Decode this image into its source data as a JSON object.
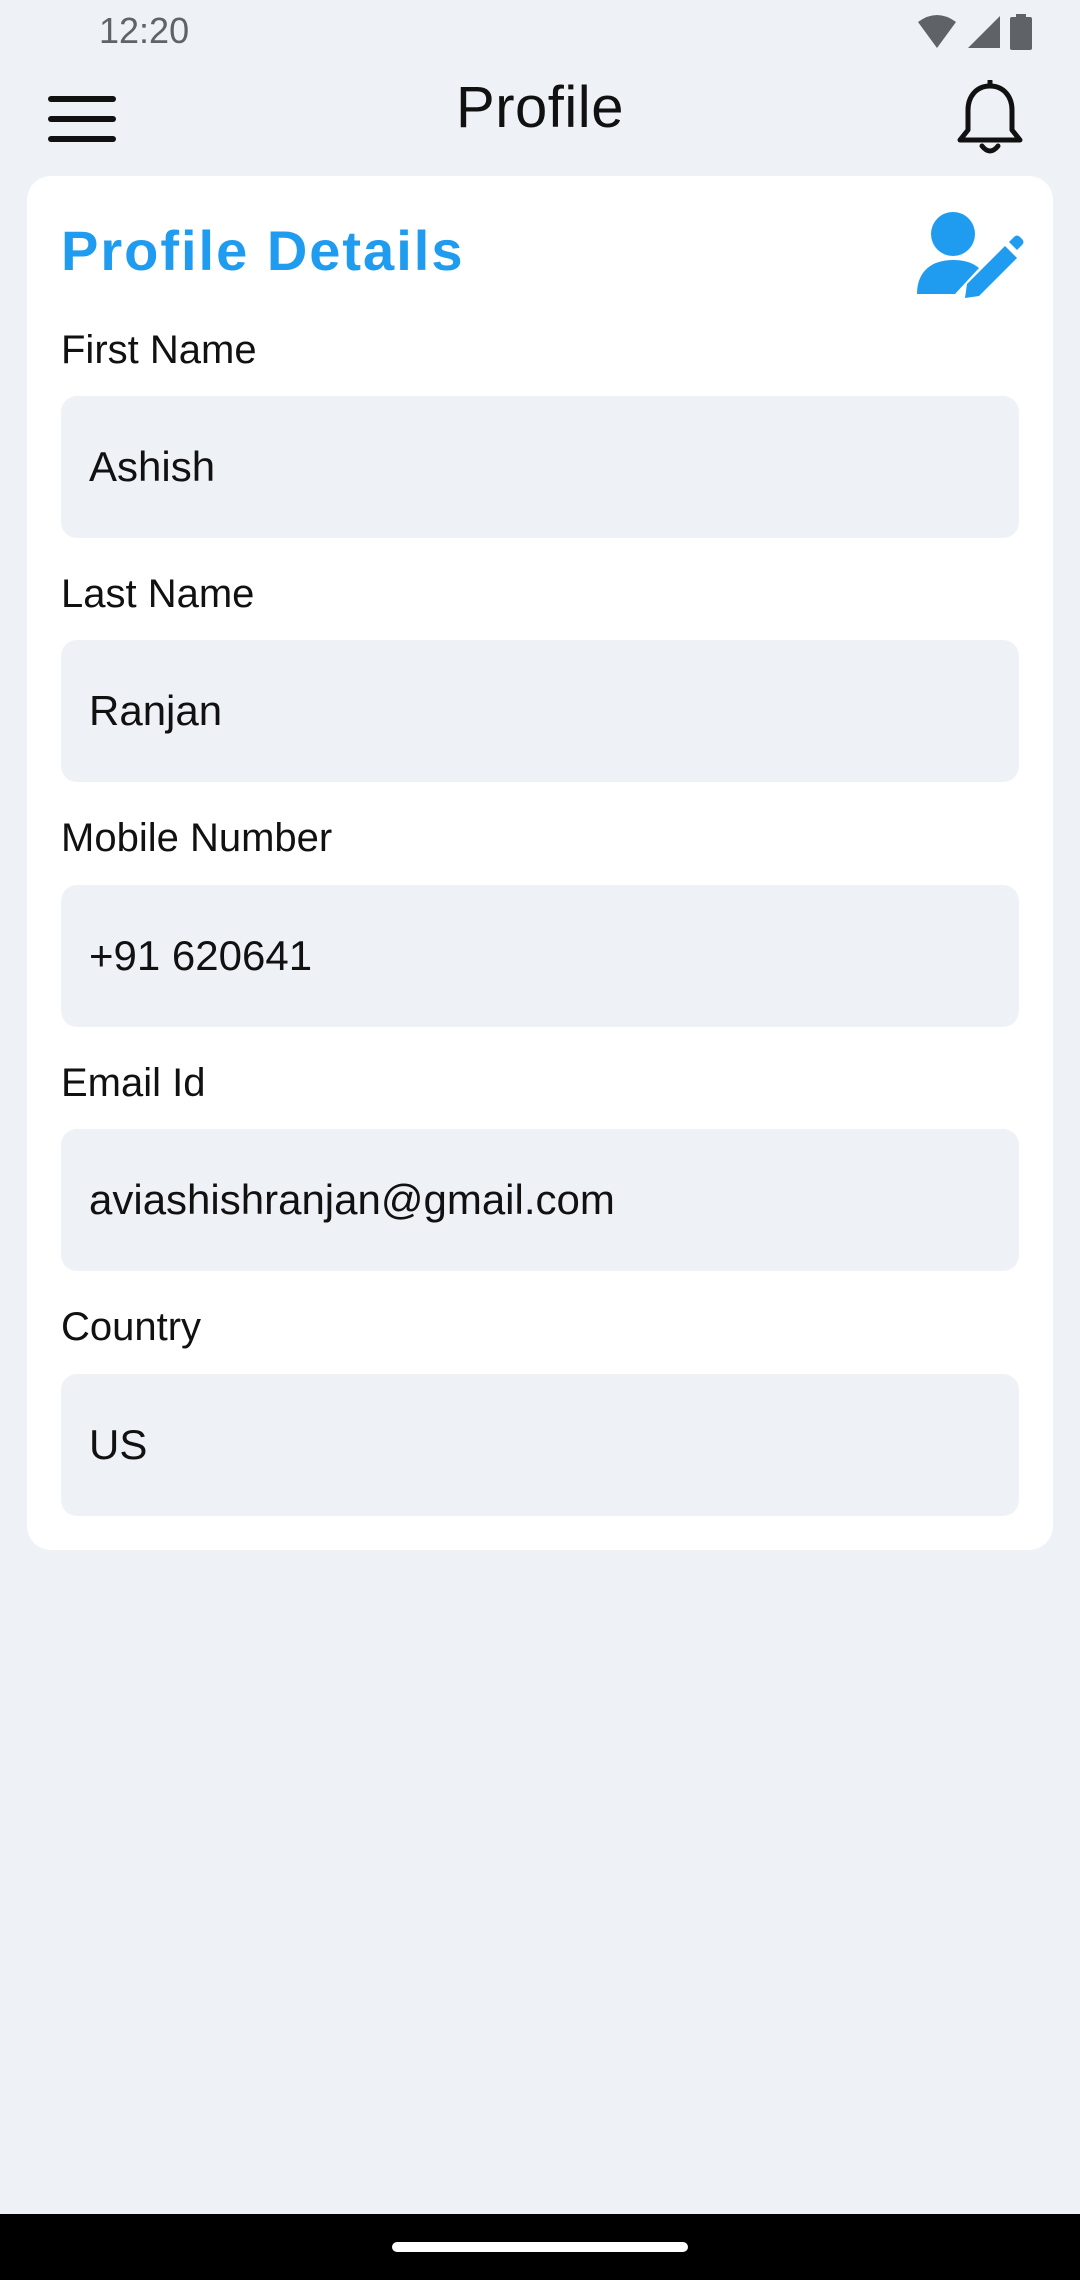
{
  "status_bar": {
    "time": "12:20",
    "icons": [
      "wifi-icon",
      "cellular-signal-icon",
      "battery-icon"
    ]
  },
  "app_bar": {
    "title": "Profile",
    "menu_icon": "hamburger-menu-icon",
    "notification_icon": "bell-icon"
  },
  "card": {
    "title": "Profile Details",
    "edit_icon": "user-edit-icon",
    "accent_color": "#1f9bf0",
    "fields": [
      {
        "label": "First Name",
        "value": "Ashish"
      },
      {
        "label": "Last Name",
        "value": "Ranjan"
      },
      {
        "label": "Mobile Number",
        "value": "+91 620641"
      },
      {
        "label": "Email Id",
        "value": "aviashishranjan@gmail.com"
      },
      {
        "label": "Country",
        "value": "US"
      }
    ]
  },
  "colors": {
    "background": "#eef1f6",
    "card": "#ffffff",
    "accent": "#1f9bf0",
    "nav_bar": "#000000"
  }
}
